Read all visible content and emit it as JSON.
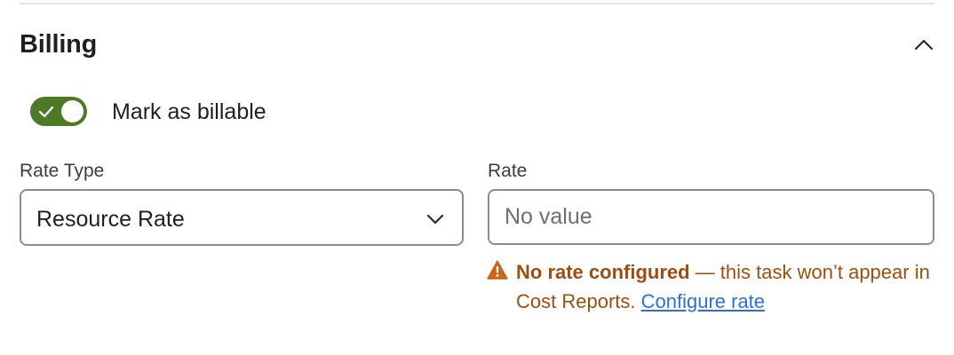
{
  "section": {
    "title": "Billing",
    "collapse_icon": "chevron-up-icon"
  },
  "billable_toggle": {
    "label": "Mark as billable",
    "checked": true,
    "color": "#4e7a27"
  },
  "rate_type": {
    "label": "Rate Type",
    "selected": "Resource Rate",
    "icon": "chevron-down-icon"
  },
  "rate": {
    "label": "Rate",
    "value": "",
    "placeholder": "No value"
  },
  "warning": {
    "icon": "warning-triangle-icon",
    "title": "No rate configured",
    "message": " — this task won’t appear in Cost Reports. ",
    "link": "Configure rate",
    "color": "#9a4f12",
    "link_color": "#2f6fd6"
  }
}
